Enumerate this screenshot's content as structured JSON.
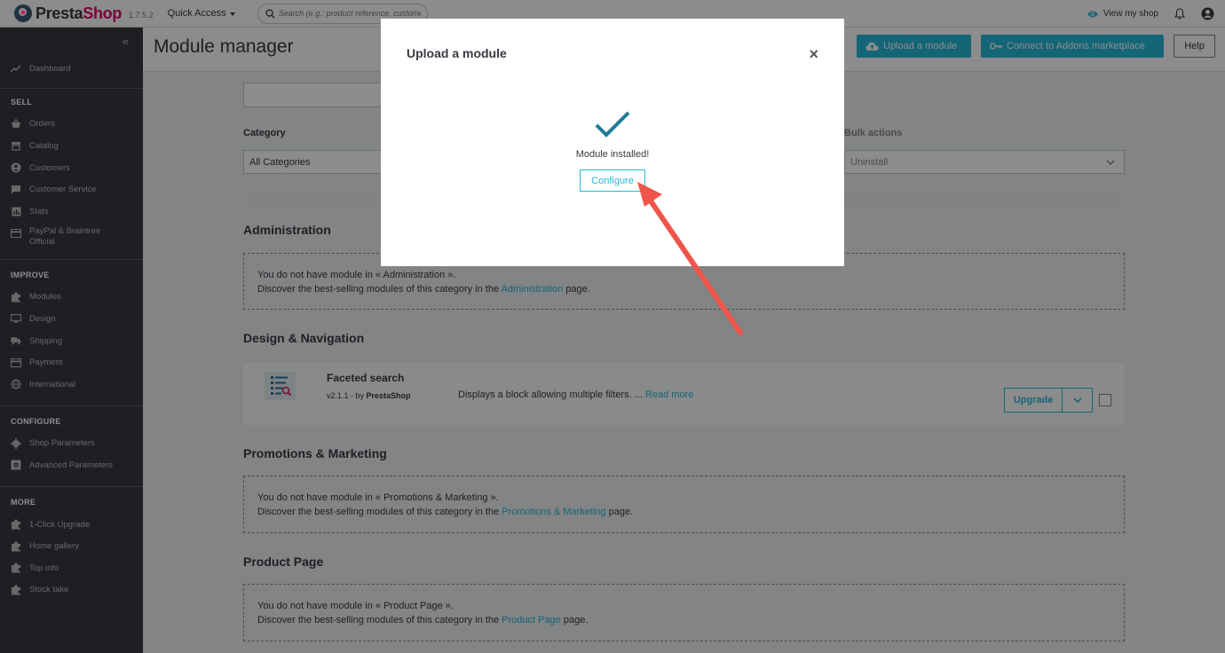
{
  "header": {
    "logo_prefix": "Presta",
    "logo_suffix": "Shop",
    "version": "1.7.5.2",
    "quick_access": "Quick Access",
    "search_placeholder": "Search (e.g.: product reference, customer name…)",
    "view_shop": "View my shop"
  },
  "sidebar": {
    "dashboard": "Dashboard",
    "sections": [
      {
        "title": "SELL",
        "items": [
          "Orders",
          "Catalog",
          "Customers",
          "Customer Service",
          "Stats",
          "PayPal & Braintree Official"
        ]
      },
      {
        "title": "IMPROVE",
        "items": [
          "Modules",
          "Design",
          "Shipping",
          "Payment",
          "International"
        ]
      },
      {
        "title": "CONFIGURE",
        "items": [
          "Shop Parameters",
          "Advanced Parameters"
        ]
      },
      {
        "title": "MORE",
        "items": [
          "1-Click Upgrade",
          "Home gallery",
          "Top info",
          "Stock take"
        ]
      }
    ]
  },
  "page": {
    "title": "Module manager",
    "upload_btn": "Upload a module",
    "connect_btn": "Connect to Addons marketplace",
    "help_btn": "Help"
  },
  "filters": {
    "category_label": "Category",
    "category_value": "All Categories",
    "bulk_label": "Bulk actions",
    "bulk_value": "Uninstall"
  },
  "categories": {
    "administration": {
      "title": "Administration",
      "line1": "You do not have module in « Administration ».",
      "line2_pre": "Discover the best-selling modules of this category in the ",
      "link": "Administration",
      "line2_post": " page."
    },
    "design": {
      "title": "Design & Navigation"
    },
    "promotions": {
      "title": "Promotions & Marketing",
      "line1": "You do not have module in « Promotions & Marketing ».",
      "line2_pre": "Discover the best-selling modules of this category in the ",
      "link": "Promotions & Marketing",
      "line2_post": " page."
    },
    "product": {
      "title": "Product Page",
      "line1": "You do not have module in « Product Page ».",
      "line2_pre": "Discover the best-selling modules of this category in the ",
      "link": "Product Page",
      "line2_post": " page."
    }
  },
  "module": {
    "name": "Faceted search",
    "version_by": "v2.1.1 - by ",
    "author": "PrestaShop",
    "description": "Displays a block allowing multiple filters. ... ",
    "read_more": "Read more",
    "upgrade": "Upgrade"
  },
  "modal": {
    "title": "Upload a module",
    "close": "×",
    "message": "Module installed!",
    "configure": "Configure"
  },
  "colors": {
    "accent": "#25b9d7",
    "sidebar": "#363a41",
    "brand_pink": "#df0067",
    "arrow": "#f0554a",
    "check": "#1f7a99"
  }
}
